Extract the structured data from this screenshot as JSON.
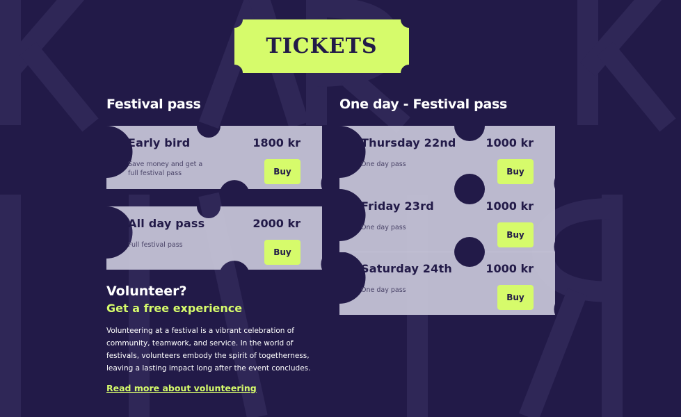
{
  "header": {
    "title": "TICKETS"
  },
  "festival_pass": {
    "heading": "Festival pass",
    "tickets": [
      {
        "name": "Early bird",
        "price": "1800 kr",
        "description": "Save money and get a full festival pass",
        "button": "Buy"
      },
      {
        "name": "All day pass",
        "price": "2000 kr",
        "description": "Full festival pass",
        "button": "Buy"
      }
    ]
  },
  "one_day_pass": {
    "heading": "One day - Festival pass",
    "tickets": [
      {
        "name": "Thursday 22nd",
        "price": "1000 kr",
        "description": "One day pass",
        "button": "Buy"
      },
      {
        "name": "Friday 23rd",
        "price": "1000 kr",
        "description": "One day pass",
        "button": "Buy"
      },
      {
        "name": "Saturday 24th",
        "price": "1000 kr",
        "description": "One day pass",
        "button": "Buy"
      }
    ]
  },
  "volunteer": {
    "title": "Volunteer?",
    "subtitle": "Get a free experience",
    "text": "Volunteering at a festival is a vibrant celebration of community, teamwork, and service. In the world of festivals, volunteers embody the spirit of togetherness, leaving a lasting impact long after the event concludes.",
    "link": "Read more about volunteering"
  },
  "colors": {
    "background": "#221a48",
    "accent": "#d6fb6b",
    "ticket": "#c4c2d6"
  }
}
